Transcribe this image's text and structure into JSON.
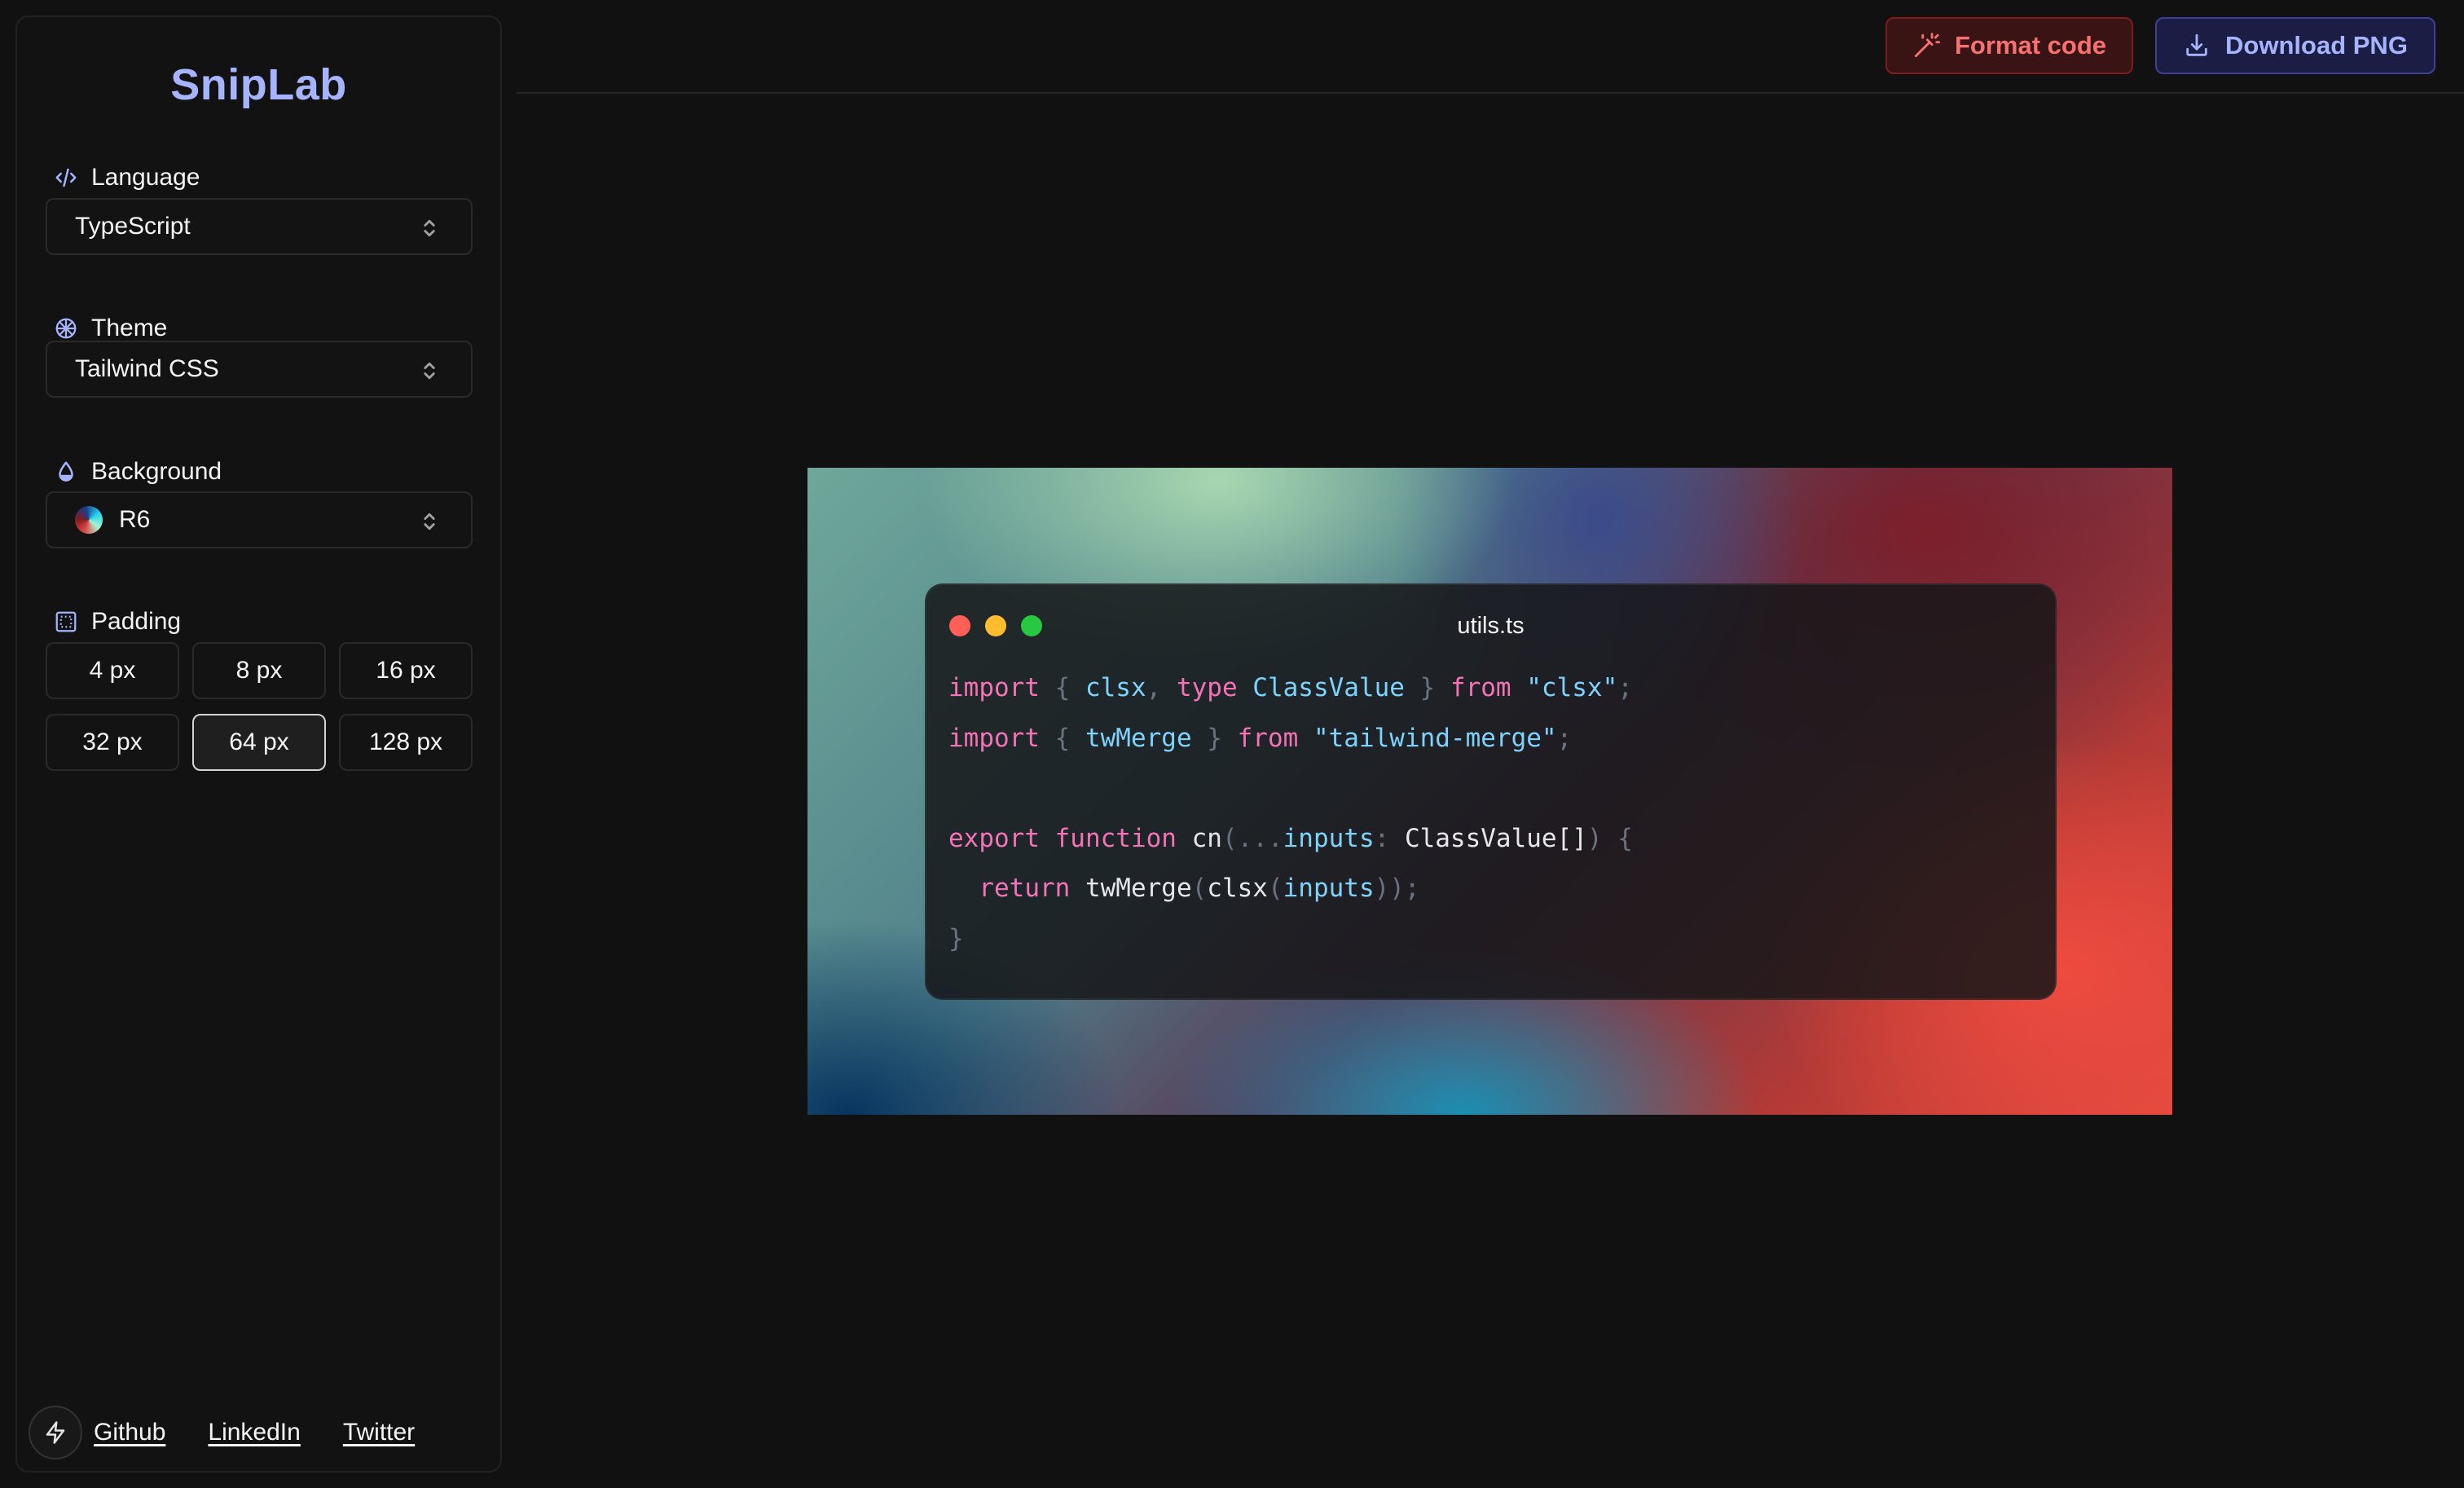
{
  "brand": "SnipLab",
  "sidebar": {
    "language": {
      "label": "Language",
      "value": "TypeScript"
    },
    "theme": {
      "label": "Theme",
      "value": "Tailwind CSS"
    },
    "background": {
      "label": "Background",
      "value": "R6"
    },
    "padding": {
      "label": "Padding",
      "options": [
        "4 px",
        "8 px",
        "16 px",
        "32 px",
        "64 px",
        "128 px"
      ],
      "selected": "64 px"
    }
  },
  "footer": {
    "links": [
      "Github",
      "LinkedIn",
      "Twitter"
    ]
  },
  "toolbar": {
    "format_label": "Format code",
    "download_label": "Download PNG"
  },
  "editor": {
    "filename": "utils.ts",
    "lines": [
      [
        [
          "k",
          "import"
        ],
        [
          "p",
          " { "
        ],
        [
          "v",
          "clsx"
        ],
        [
          "p",
          ", "
        ],
        [
          "k",
          "type"
        ],
        [
          "v",
          " ClassValue"
        ],
        [
          "p",
          " } "
        ],
        [
          "k",
          "from"
        ],
        [
          "s",
          " \"clsx\""
        ],
        [
          "p",
          ";"
        ]
      ],
      [
        [
          "k",
          "import"
        ],
        [
          "p",
          " { "
        ],
        [
          "v",
          "twMerge"
        ],
        [
          "p",
          " } "
        ],
        [
          "k",
          "from"
        ],
        [
          "s",
          " \"tailwind-merge\""
        ],
        [
          "p",
          ";"
        ]
      ],
      [],
      [
        [
          "k",
          "export"
        ],
        [
          "k",
          " function"
        ],
        [
          "f",
          " cn"
        ],
        [
          "p",
          "(..."
        ],
        [
          "v",
          "inputs"
        ],
        [
          "p",
          ": "
        ],
        [
          "t",
          "ClassValue[]"
        ],
        [
          "p",
          ") {"
        ]
      ],
      [
        [
          "p",
          "  "
        ],
        [
          "k",
          "return"
        ],
        [
          "f",
          " twMerge"
        ],
        [
          "p",
          "("
        ],
        [
          "f",
          "clsx"
        ],
        [
          "p",
          "("
        ],
        [
          "v",
          "inputs"
        ],
        [
          "p",
          "));"
        ]
      ],
      [
        [
          "p",
          "}"
        ]
      ]
    ]
  },
  "colors": {
    "brand": "#a5b4fc",
    "format_accent": "#f87171",
    "download_accent": "#a5b4fc",
    "keyword": "#f472b6",
    "identifier": "#7dd3fc"
  }
}
